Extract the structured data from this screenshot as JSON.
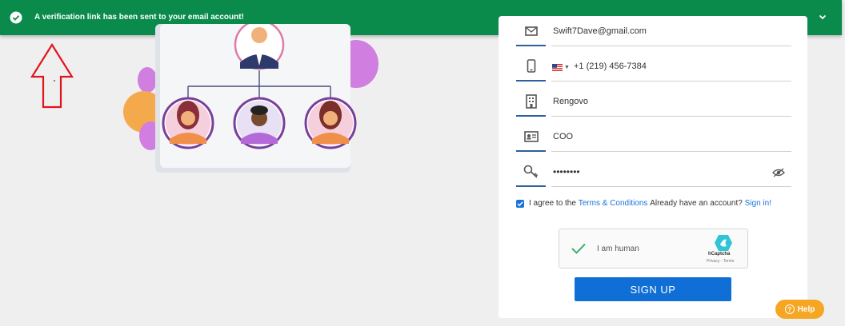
{
  "toast": {
    "message": "A verification link has been sent to your email account!",
    "icon_check": "check-circle-icon",
    "icon_chevron": "chevron-down-icon",
    "color": "#0a8a4b"
  },
  "form": {
    "email": "Swift7Dave@gmail.com",
    "phone": "+1 (219) 456-7384",
    "company": "Rengovo",
    "job_title": "COO",
    "password_masked": "••••••••",
    "agree_prefix": "I agree to the",
    "terms_link": "Terms & Conditions",
    "have_account": "Already have an account?",
    "signin_link": "Sign in!",
    "captcha_label": "I am human",
    "captcha_brand": "hCaptcha",
    "captcha_links": "Privacy - Terms",
    "signup_label": "SIGN UP"
  },
  "help": {
    "label": "Help"
  },
  "colors": {
    "accent": "#0f6fd6",
    "help": "#f5a623",
    "icon_underline": "#2b5f9e"
  }
}
